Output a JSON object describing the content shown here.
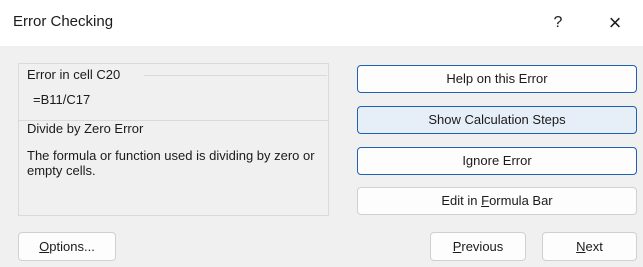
{
  "dialog": {
    "title": "Error Checking",
    "help_glyph": "?",
    "close_glyph": "×"
  },
  "error": {
    "cell_label": "Error in cell C20",
    "formula": "=B11/C17",
    "type_label": "Divide by Zero Error",
    "description": "The formula or function used is dividing by zero or empty cells."
  },
  "actions": {
    "help_on_error": "Help on this Error",
    "show_calc_steps": "Show Calculation Steps",
    "ignore_error": "Ignore Error",
    "edit_formula_bar": {
      "prefix": "Edit in ",
      "mnemonic": "F",
      "suffix": "ormula Bar"
    }
  },
  "footer": {
    "options": {
      "mnemonic": "O",
      "suffix": "ptions..."
    },
    "previous": {
      "mnemonic": "P",
      "suffix": "revious"
    },
    "next": {
      "mnemonic": "N",
      "suffix": "ext"
    }
  }
}
